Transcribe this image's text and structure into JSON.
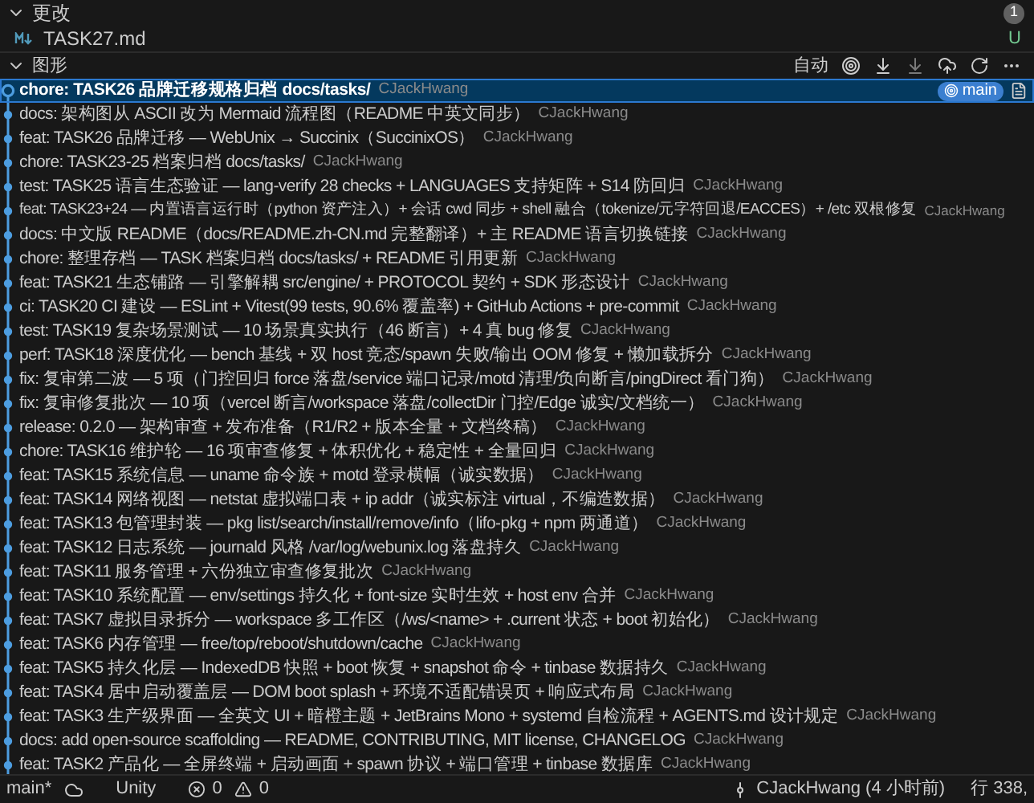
{
  "changes": {
    "title": "更改",
    "count": "1",
    "expanded": true,
    "files": [
      {
        "name": "TASK27.md",
        "status": "U"
      }
    ]
  },
  "graph": {
    "title": "图形",
    "expanded": true,
    "mode": "自动",
    "commits": [
      {
        "message": "chore: TASK26 品牌迁移规格归档 docs/tasks/",
        "author": "CJackHwang",
        "selected": true,
        "ref": "main"
      },
      {
        "message": "docs: 架构图从 ASCII 改为 Mermaid 流程图（README 中英文同步）",
        "author": "CJackHwang",
        "selected": false
      },
      {
        "message": "feat: TASK26 品牌迁移 — WebUnix → Succinix（SuccinixOS）",
        "author": "CJackHwang",
        "selected": false
      },
      {
        "message": "chore: TASK23-25 档案归档 docs/tasks/",
        "author": "CJackHwang",
        "selected": false
      },
      {
        "message": "test: TASK25 语言生态验证 — lang-verify 28 checks + LANGUAGES 支持矩阵 + S14 防回归",
        "author": "CJackHwang",
        "selected": false
      },
      {
        "message": "feat: TASK23+24 — 内置语言运行时（python 资产注入）+ 会话 cwd 同步 + shell 融合（tokenize/元字符回退/EACCES）+ /etc 双根修复",
        "author": "CJackHwang",
        "selected": false
      },
      {
        "message": "docs: 中文版 README（docs/README.zh-CN.md 完整翻译）+ 主 README 语言切换链接",
        "author": "CJackHwang",
        "selected": false
      },
      {
        "message": "chore: 整理存档 — TASK 档案归档 docs/tasks/ + README 引用更新",
        "author": "CJackHwang",
        "selected": false
      },
      {
        "message": "feat: TASK21 生态铺路 — 引擎解耦 src/engine/ + PROTOCOL 契约 + SDK 形态设计",
        "author": "CJackHwang",
        "selected": false
      },
      {
        "message": "ci: TASK20 CI 建设 — ESLint + Vitest(99 tests, 90.6% 覆盖率) + GitHub Actions + pre-commit",
        "author": "CJackHwang",
        "selected": false
      },
      {
        "message": "test: TASK19 复杂场景测试 — 10 场景真实执行（46 断言）+ 4 真 bug 修复",
        "author": "CJackHwang",
        "selected": false
      },
      {
        "message": "perf: TASK18 深度优化 — bench 基线 + 双 host 竞态/spawn 失败/输出 OOM 修复 + 懒加载拆分",
        "author": "CJackHwang",
        "selected": false
      },
      {
        "message": "fix: 复审第二波 — 5 项（门控回归 force 落盘/service 端口记录/motd 清理/负向断言/pingDirect 看门狗）",
        "author": "CJackHwang",
        "selected": false
      },
      {
        "message": "fix: 复审修复批次 — 10 项（vercel 断言/workspace 落盘/collectDir 门控/Edge 诚实/文档统一）",
        "author": "CJackHwang",
        "selected": false
      },
      {
        "message": "release: 0.2.0 — 架构审查 + 发布准备（R1/R2 + 版本全量 + 文档终稿）",
        "author": "CJackHwang",
        "selected": false
      },
      {
        "message": "chore: TASK16 维护轮 — 16 项审查修复 + 体积优化 + 稳定性 + 全量回归",
        "author": "CJackHwang",
        "selected": false
      },
      {
        "message": "feat: TASK15 系统信息 — uname 命令族 + motd 登录横幅（诚实数据）",
        "author": "CJackHwang",
        "selected": false
      },
      {
        "message": "feat: TASK14 网络视图 — netstat 虚拟端口表 + ip addr（诚实标注 virtual，不编造数据）",
        "author": "CJackHwang",
        "selected": false
      },
      {
        "message": "feat: TASK13 包管理封装 — pkg list/search/install/remove/info（lifo-pkg + npm 两通道）",
        "author": "CJackHwang",
        "selected": false
      },
      {
        "message": "feat: TASK12 日志系统 — journald 风格 /var/log/webunix.log 落盘持久",
        "author": "CJackHwang",
        "selected": false
      },
      {
        "message": "feat: TASK11 服务管理 + 六份独立审查修复批次",
        "author": "CJackHwang",
        "selected": false
      },
      {
        "message": "feat: TASK10 系统配置 — env/settings 持久化 + font-size 实时生效 + host env 合并",
        "author": "CJackHwang",
        "selected": false
      },
      {
        "message": "feat: TASK7 虚拟目录拆分 — workspace 多工作区（/ws/<name> + .current 状态 + boot 初始化）",
        "author": "CJackHwang",
        "selected": false
      },
      {
        "message": "feat: TASK6 内存管理 — free/top/reboot/shutdown/cache",
        "author": "CJackHwang",
        "selected": false
      },
      {
        "message": "feat: TASK5 持久化层 — IndexedDB 快照 + boot 恢复 + snapshot 命令 + tinbase 数据持久",
        "author": "CJackHwang",
        "selected": false
      },
      {
        "message": "feat: TASK4 居中启动覆盖层 — DOM boot splash + 环境不适配错误页 + 响应式布局",
        "author": "CJackHwang",
        "selected": false
      },
      {
        "message": "feat: TASK3 生产级界面 — 全英文 UI + 暗橙主题 + JetBrains Mono + systemd 自检流程 + AGENTS.md 设计规定",
        "author": "CJackHwang",
        "selected": false
      },
      {
        "message": "docs: add open-source scaffolding — README, CONTRIBUTING, MIT license, CHANGELOG",
        "author": "CJackHwang",
        "selected": false
      },
      {
        "message": "feat: TASK2 产品化 — 全屏终端 + 启动画面 + spawn 协议 + 端口管理 + tinbase 数据库",
        "author": "CJackHwang",
        "selected": false
      }
    ]
  },
  "status_bar": {
    "branch": "main*",
    "project": "Unity",
    "errors": "0",
    "warnings": "0",
    "last_commit": "CJackHwang (4 小时前)",
    "position": "行 338,"
  }
}
